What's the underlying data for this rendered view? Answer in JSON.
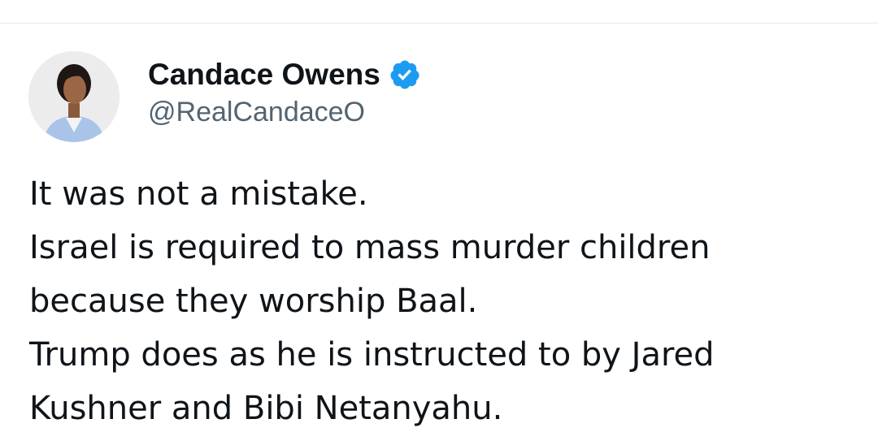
{
  "tweet": {
    "author": {
      "display_name": "Candace Owens",
      "handle": "@RealCandaceO",
      "verified": true,
      "verified_color": "#1d9bf0",
      "avatar_icon": "profile-photo"
    },
    "lines": [
      "It was not a mistake.",
      "Israel is required to mass murder children",
      "because they worship Baal.",
      "Trump does as he is instructed to by Jared",
      "Kushner and Bibi Netanyahu."
    ]
  },
  "colors": {
    "text": "#0f1419",
    "secondary": "#536471",
    "divider": "#e6e9ec"
  }
}
